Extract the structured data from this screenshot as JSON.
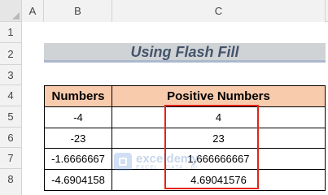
{
  "columns": [
    "A",
    "B",
    "C"
  ],
  "rows": [
    "1",
    "2",
    "3",
    "4",
    "5",
    "6",
    "7",
    "8"
  ],
  "title": "Using Flash Fill",
  "table": {
    "headers": [
      "Numbers",
      "Positive Numbers"
    ],
    "rows": [
      [
        "-4",
        "4"
      ],
      [
        "-23",
        "23"
      ],
      [
        "-1.6666667",
        "1.666666667"
      ],
      [
        "-4.6904158",
        "4.69041576"
      ]
    ]
  },
  "colors": {
    "header_fill": "#f8cbad",
    "title_fill": "#d0d3d6",
    "title_text": "#44546a",
    "highlight_border": "#e32319"
  },
  "watermark": {
    "name": "exceldemy",
    "tagline": "EXCEL · DATA · BI"
  }
}
